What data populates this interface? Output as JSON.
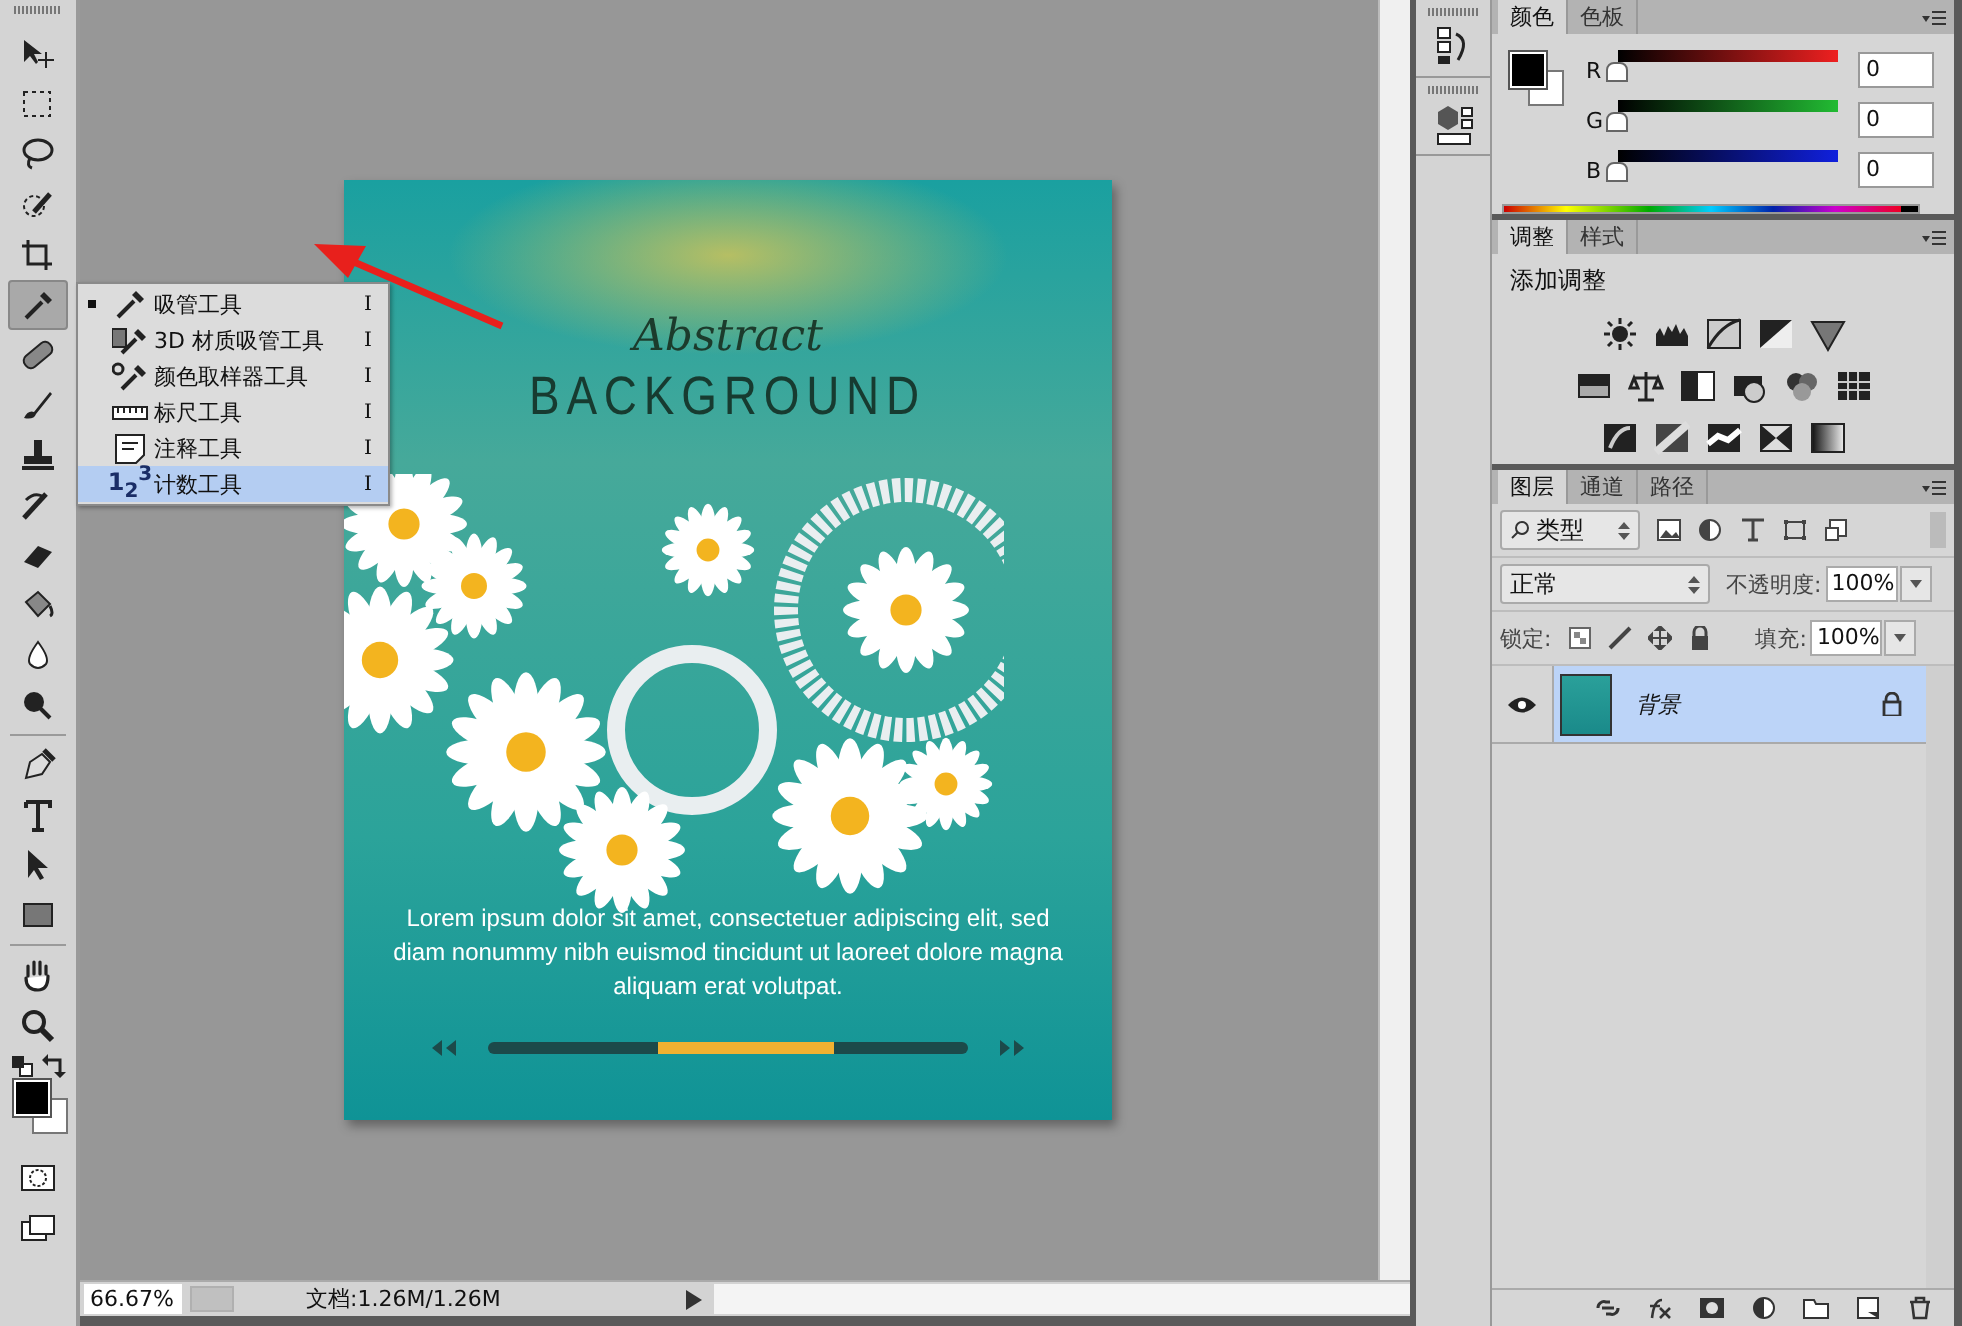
{
  "toolbar": {
    "tools": [
      {
        "selected": false
      },
      {
        "selected": false
      },
      {
        "selected": false
      },
      {
        "selected": false
      },
      {
        "selected": false
      },
      {
        "selected": true
      },
      {
        "selected": false
      },
      {
        "selected": false
      },
      {
        "selected": false
      },
      {
        "selected": false
      },
      {
        "selected": false
      },
      {
        "selected": false
      },
      {
        "selected": false
      },
      {
        "selected": false
      },
      {
        "selected": false
      },
      {
        "selected": false
      },
      {
        "selected": false
      },
      {
        "selected": false
      },
      {
        "selected": false
      },
      {
        "selected": false
      }
    ]
  },
  "flyout_menu": {
    "items": [
      {
        "label": "吸管工具",
        "shortcut": "I",
        "current": true,
        "selected": false
      },
      {
        "label": "3D 材质吸管工具",
        "shortcut": "I",
        "current": false,
        "selected": false
      },
      {
        "label": "颜色取样器工具",
        "shortcut": "I",
        "current": false,
        "selected": false
      },
      {
        "label": "标尺工具",
        "shortcut": "I",
        "current": false,
        "selected": false
      },
      {
        "label": "注释工具",
        "shortcut": "I",
        "current": false,
        "selected": false
      },
      {
        "label": "计数工具",
        "shortcut": "I",
        "current": false,
        "selected": true,
        "glyph": "1$_{2}$$^{3}$"
      }
    ]
  },
  "document": {
    "script_title": "Abstract",
    "title": "BACKGROUND",
    "body": "Lorem ipsum dolor sit amet, consectetuer adipiscing elit, sed diam nonummy nibh euismod tincidunt ut laoreet dolore magna aliquam erat volutpat."
  },
  "status_bar": {
    "zoom": "66.67%",
    "doc_info": "文档:1.26M/1.26M"
  },
  "color_panel": {
    "tabs": [
      {
        "label": "颜色",
        "selected": true
      },
      {
        "label": "色板",
        "selected": false
      }
    ],
    "channels": [
      {
        "name": "R",
        "level": 0,
        "value": "0"
      },
      {
        "name": "G",
        "level": 0,
        "value": "0"
      },
      {
        "name": "B",
        "level": 0,
        "value": "0"
      }
    ]
  },
  "adjustments_panel": {
    "tabs": [
      {
        "label": "调整",
        "selected": true
      },
      {
        "label": "样式",
        "selected": false
      }
    ],
    "heading": "添加调整"
  },
  "layers_panel": {
    "tabs": [
      {
        "label": "图层",
        "selected": true
      },
      {
        "label": "通道",
        "selected": false
      },
      {
        "label": "路径",
        "selected": false
      }
    ],
    "filter": "类型",
    "blend_mode": "正常",
    "opacity_label": "不透明度:",
    "opacity": "100%",
    "lock_label": "锁定:",
    "fill_label": "填充:",
    "fill": "100%",
    "layers": [
      {
        "name": "背景",
        "visible": true,
        "locked": true,
        "selected": true
      }
    ]
  }
}
